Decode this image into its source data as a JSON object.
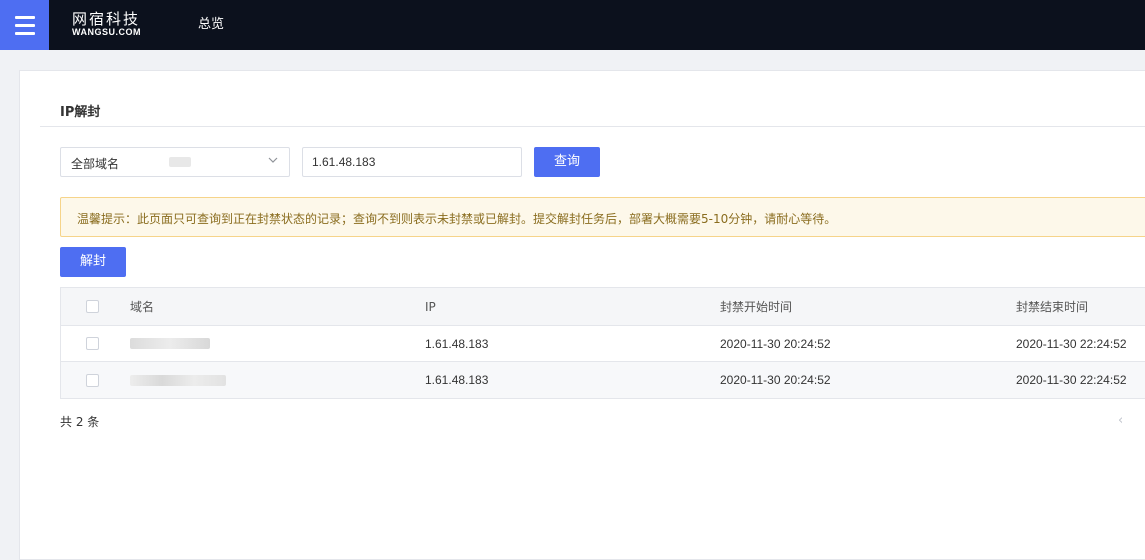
{
  "header": {
    "logo_cn": "网宿科技",
    "logo_en": "WANGSU.COM",
    "nav_overview": "总览"
  },
  "page": {
    "title": "IP解封"
  },
  "filter": {
    "domain_select_label": "全部域名",
    "ip_value": "1.61.48.183",
    "query_label": "查询"
  },
  "notice": "温馨提示：此页面只可查询到正在封禁状态的记录；查询不到则表示未封禁或已解封。提交解封任务后，部署大概需要5-10分钟，请耐心等待。",
  "actions": {
    "unblock_label": "解封"
  },
  "table": {
    "headers": {
      "domain": "域名",
      "ip": "IP",
      "start": "封禁开始时间",
      "end": "封禁结束时间"
    },
    "rows": [
      {
        "ip": "1.61.48.183",
        "start": "2020-11-30 20:24:52",
        "end": "2020-11-30 22:24:52"
      },
      {
        "ip": "1.61.48.183",
        "start": "2020-11-30 20:24:52",
        "end": "2020-11-30 22:24:52"
      }
    ]
  },
  "pagination": {
    "total_text": "共 2 条",
    "prev_icon": "‹"
  },
  "colors": {
    "primary": "#4e6ef2",
    "topbar": "#0c111d",
    "notice_bg": "#fdf8ea"
  }
}
